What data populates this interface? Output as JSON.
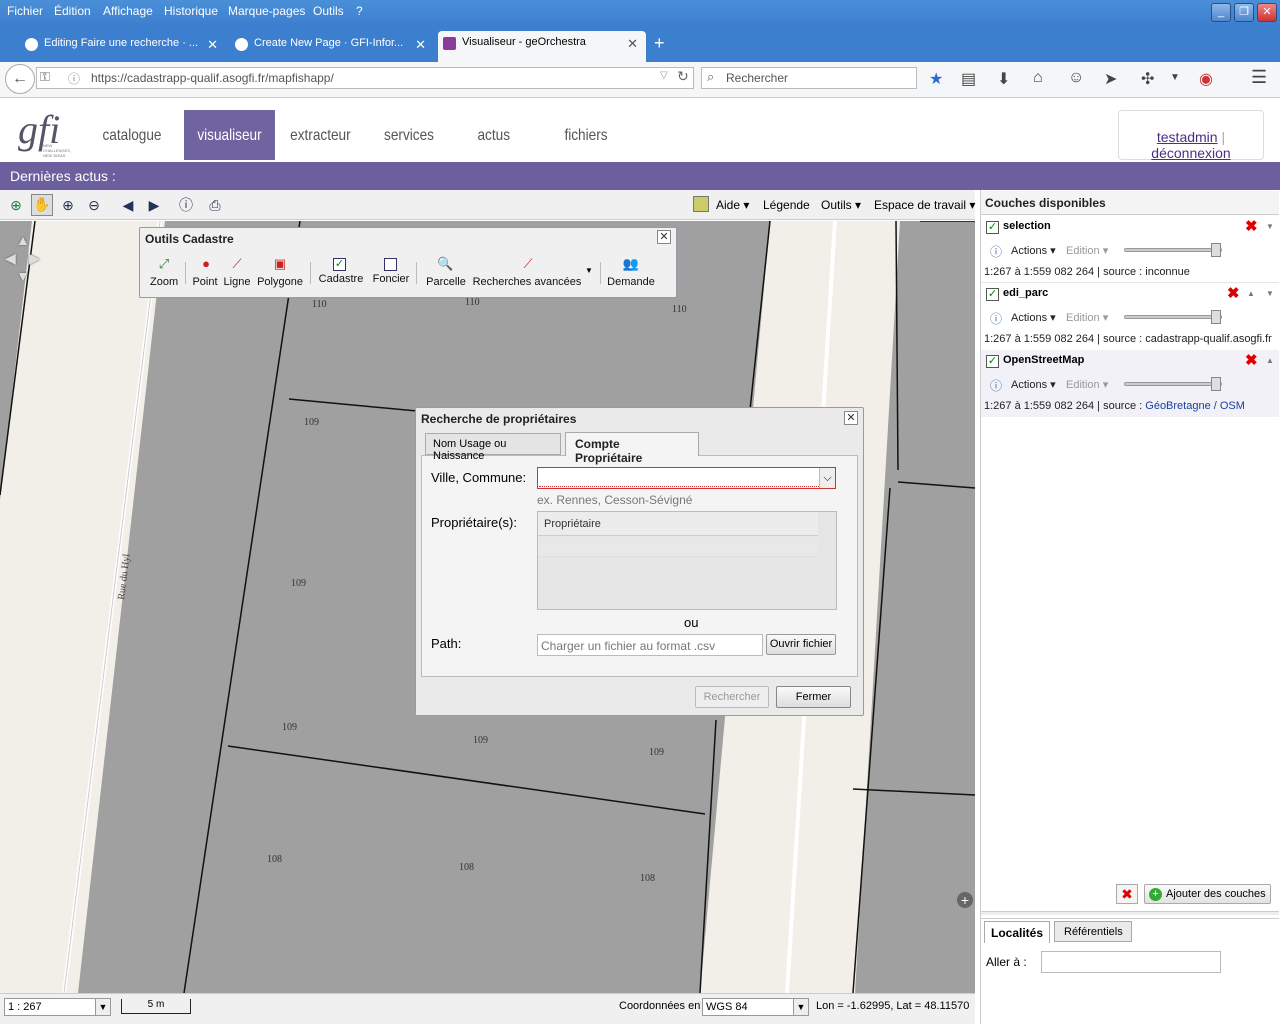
{
  "browser": {
    "menu": [
      "Fichier",
      "Édition",
      "Affichage",
      "Historique",
      "Marque-pages",
      "Outils",
      "?"
    ],
    "tabs": [
      {
        "title": "Editing Faire une recherche · ..."
      },
      {
        "title": "Create New Page · GFI-Infor..."
      },
      {
        "title": "Visualiseur - geOrchestra"
      }
    ],
    "url": "https://cadastrapp-qualif.asogfi.fr/mapfishapp/",
    "search_placeholder": "Rechercher"
  },
  "app": {
    "nav": [
      "catalogue",
      "visualiseur",
      "extracteur",
      "services",
      "actus",
      "fichiers"
    ],
    "active_nav": "visualiseur",
    "user": "testadmin",
    "logout": "déconnexion",
    "news": "Dernières actus :",
    "logo": "gfi",
    "logo_tagline": "NEW CHALLENGES, NEW IDEAS"
  },
  "toolbar": {
    "aide": "Aide",
    "legende": "Légende",
    "outils": "Outils",
    "espace": "Espace de travail"
  },
  "cadastre": {
    "title": "Outils Cadastre",
    "tools": [
      "Zoom",
      "Point",
      "Ligne",
      "Polygone",
      "Cadastre",
      "Foncier",
      "Parcelle",
      "Recherches avancées",
      "Demande"
    ]
  },
  "map": {
    "street": "Rue du Hyl",
    "parcels": [
      "110",
      "110",
      "110",
      "109",
      "109",
      "109",
      "109",
      "109",
      "108",
      "108",
      "108"
    ]
  },
  "dialog": {
    "title": "Recherche de propriétaires",
    "tabs": [
      "Nom Usage ou Naissance",
      "Compte Propriétaire"
    ],
    "active_tab": "Compte Propriétaire",
    "ville_label": "Ville, Commune:",
    "ville_hint": "ex. Rennes, Cesson-Sévigné",
    "prop_label": "Propriétaire(s):",
    "prop_col": "Propriétaire",
    "ou": "ou",
    "path_label": "Path:",
    "path_placeholder": "Charger un fichier au format .csv",
    "open_btn": "Ouvrir fichier",
    "search_btn": "Rechercher",
    "close_btn": "Fermer"
  },
  "layers": {
    "title": "Couches disponibles",
    "items": [
      {
        "name": "selection",
        "actions": "Actions",
        "edition": "Edition",
        "info": "1:267 à 1:559 082 264 | source : inconnue"
      },
      {
        "name": "edi_parc",
        "actions": "Actions",
        "edition": "Edition",
        "info": "1:267 à 1:559 082 264 | source : cadastrapp-qualif.asogfi.fr"
      },
      {
        "name": "OpenStreetMap",
        "actions": "Actions",
        "edition": "Edition",
        "info_prefix": "1:267 à 1:559 082 264 | source : ",
        "info_link": "GéoBretagne / OSM"
      }
    ],
    "add_btn": "Ajouter des couches"
  },
  "bottom_tabs": [
    "Localités",
    "Référentiels"
  ],
  "goto_label": "Aller à :",
  "status": {
    "scale": "1 : 267",
    "scalebar": "5 m",
    "coord_label": "Coordonnées en",
    "proj": "WGS 84",
    "coords": "Lon = -1.62995, Lat = 48.11570"
  }
}
